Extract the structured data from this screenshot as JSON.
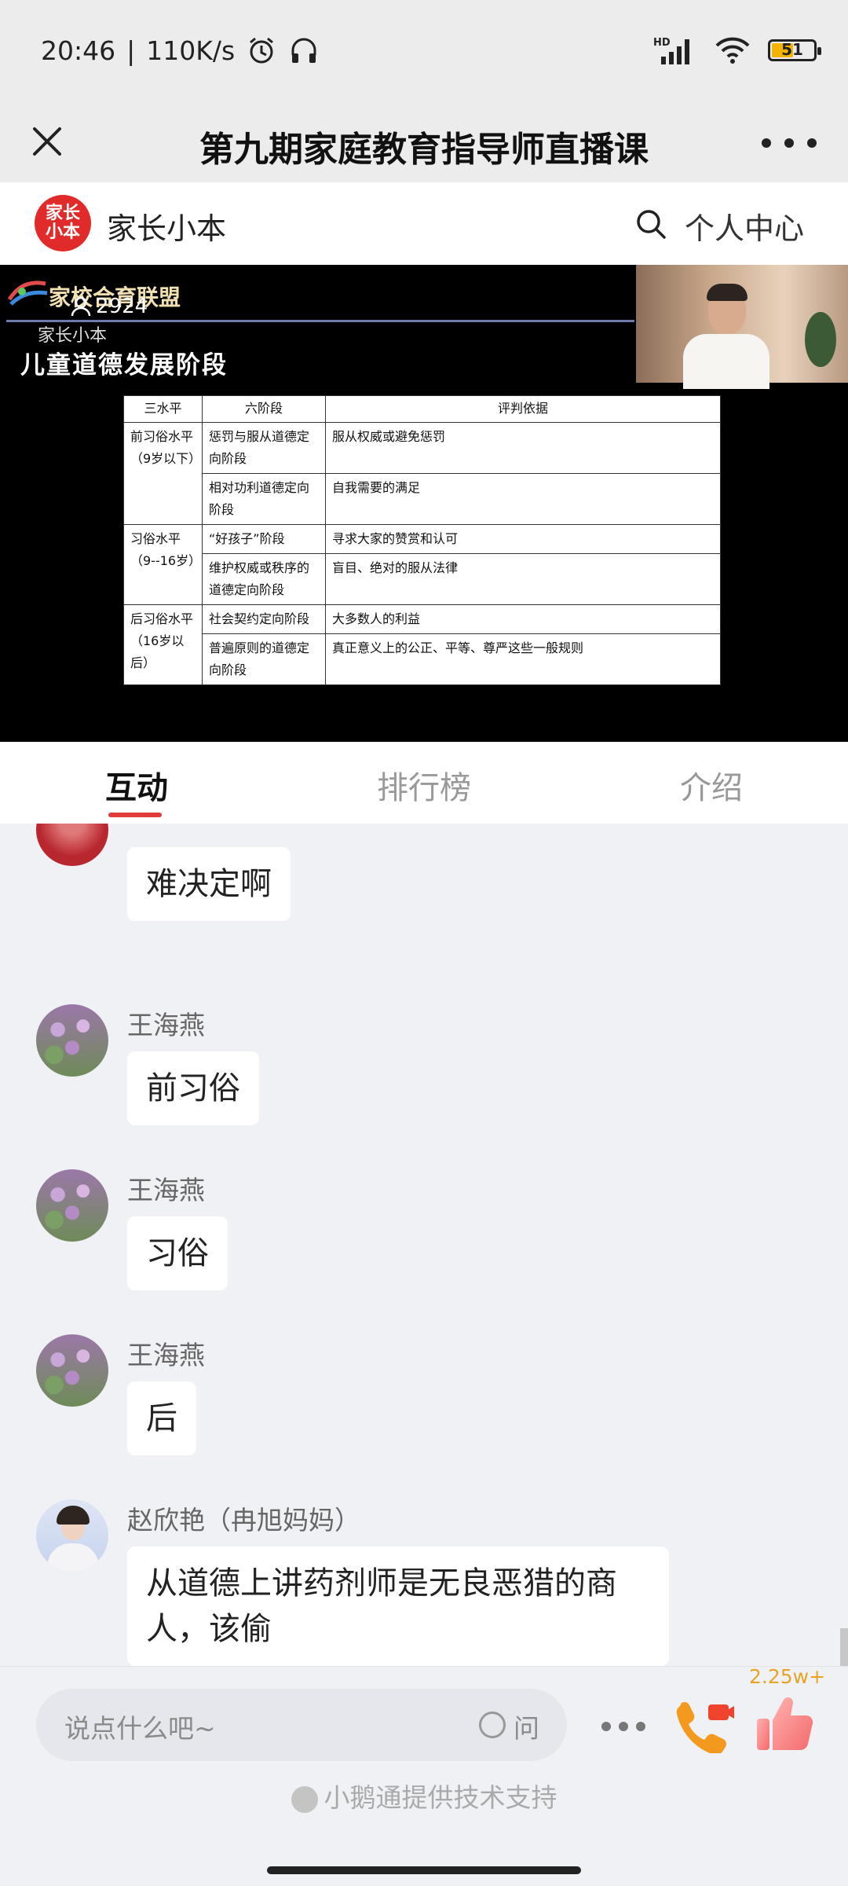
{
  "status": {
    "time": "20:46",
    "speed": "110K/s",
    "network": "HD",
    "battery": "51",
    "battery_percent": 51
  },
  "header": {
    "title": "第九期家庭教育指导师直播课"
  },
  "brand": {
    "logo_text": "家长小本",
    "name": "家长小本",
    "personal_center": "个人中心"
  },
  "video": {
    "slide_header": "家校合育联盟",
    "slide_sub": "家长小本",
    "viewers": "2924",
    "slide_title": "儿童道德发展阶段",
    "table": {
      "headers": [
        "三水平",
        "六阶段",
        "评判依据"
      ],
      "rows": [
        {
          "level": "前习俗水平（9岁以下）",
          "stage": "惩罚与服从道德定向阶段",
          "basis": "服从权威或避免惩罚"
        },
        {
          "stage": "相对功利道德定向阶段",
          "basis": "自我需要的满足"
        },
        {
          "level": "习俗水平（9--16岁）",
          "stage": "“好孩子”阶段",
          "basis": "寻求大家的赞赏和认可"
        },
        {
          "stage": "维护权威或秩序的道德定向阶段",
          "basis": "盲目、绝对的服从法律"
        },
        {
          "level": "后习俗水平（16岁以后）",
          "stage": "社会契约定向阶段",
          "basis": "大多数人的利益"
        },
        {
          "stage": "普遍原则的道德定向阶段",
          "basis": "真正意义上的公正、平等、尊严这些一般规则"
        }
      ]
    }
  },
  "tabs": [
    {
      "label": "互动"
    },
    {
      "label": "排行榜"
    },
    {
      "label": "介绍"
    }
  ],
  "messages": [
    {
      "sender": "",
      "text": "难决定啊"
    },
    {
      "sender": "王海燕",
      "text": "前习俗"
    },
    {
      "sender": "王海燕",
      "text": "习俗"
    },
    {
      "sender": "王海燕",
      "text": "后"
    },
    {
      "sender": "赵欣艳（冉旭妈妈）",
      "text": "从道德上讲药剂师是无良恶猎的商人，该偷"
    }
  ],
  "bottom": {
    "placeholder": "说点什么吧~",
    "ask_label": "问",
    "like_count": "2.25w+",
    "support": "小鹅通提供技术支持"
  },
  "colors": {
    "accent": "#e03a3a",
    "like": "#e7a426"
  }
}
